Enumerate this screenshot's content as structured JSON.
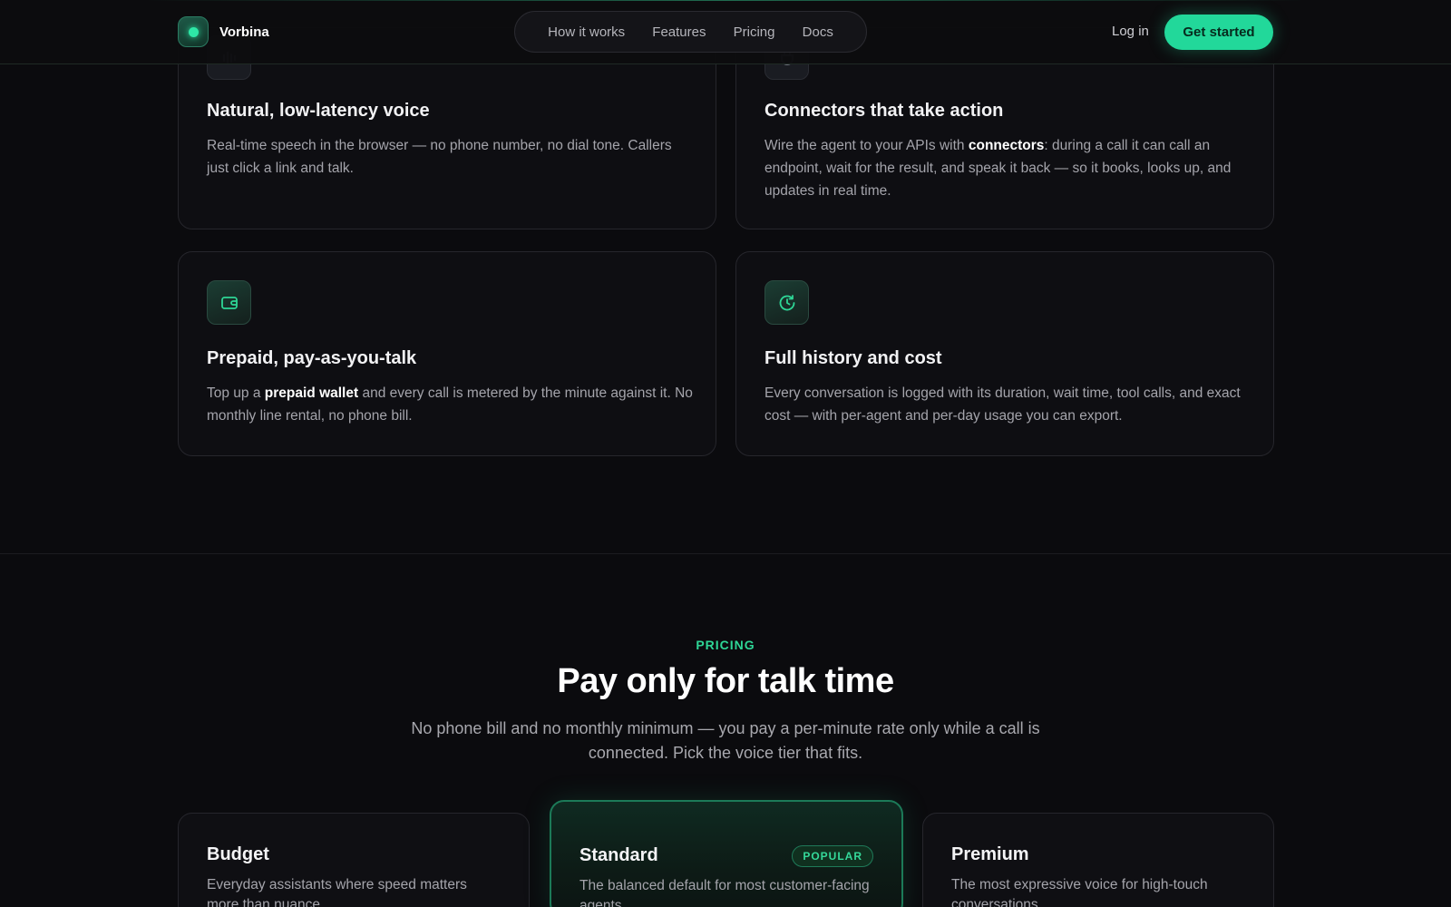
{
  "nav": {
    "brand": "Vorbina",
    "links": [
      "How it works",
      "Features",
      "Pricing",
      "Docs"
    ],
    "login": "Log in",
    "cta": "Get started"
  },
  "features": [
    {
      "title": "Natural, low-latency voice",
      "desc_parts": [
        "Real-time speech in the browser — no phone number, no dial tone. Callers just click a link and talk."
      ],
      "icon": "waveform-icon"
    },
    {
      "title": "Connectors that take action",
      "desc_parts": [
        "Wire the agent to your APIs with ",
        "connectors",
        ": during a call it can call an endpoint, wait for the result, and speak it back — so it books, looks up, and updates in real time."
      ],
      "icon": "plug-icon"
    },
    {
      "title": "Prepaid, pay-as-you-talk",
      "desc_parts": [
        "Top up a ",
        "prepaid wallet",
        " and every call is metered by the minute against it. No monthly line rental, no phone bill."
      ],
      "icon": "wallet-icon"
    },
    {
      "title": "Full history and cost",
      "desc_parts": [
        "Every conversation is logged with its duration, wait time, tool calls, and exact cost — with per-agent and per-day usage you can export."
      ],
      "icon": "history-icon"
    }
  ],
  "pricing": {
    "eyebrow": "PRICING",
    "title": "Pay only for talk time",
    "subtitle": "No phone bill and no monthly minimum — you pay a per-minute rate only while a call is connected. Pick the voice tier that fits.",
    "tiers": [
      {
        "name": "Budget",
        "desc": "Everyday assistants where speed matters more than nuance."
      },
      {
        "name": "Standard",
        "desc": "The balanced default for most customer-facing agents.",
        "badge": "POPULAR"
      },
      {
        "name": "Premium",
        "desc": "The most expressive voice for high-touch conversations."
      }
    ]
  },
  "colors": {
    "accent": "#22d89a",
    "background": "#0b0b0e"
  }
}
